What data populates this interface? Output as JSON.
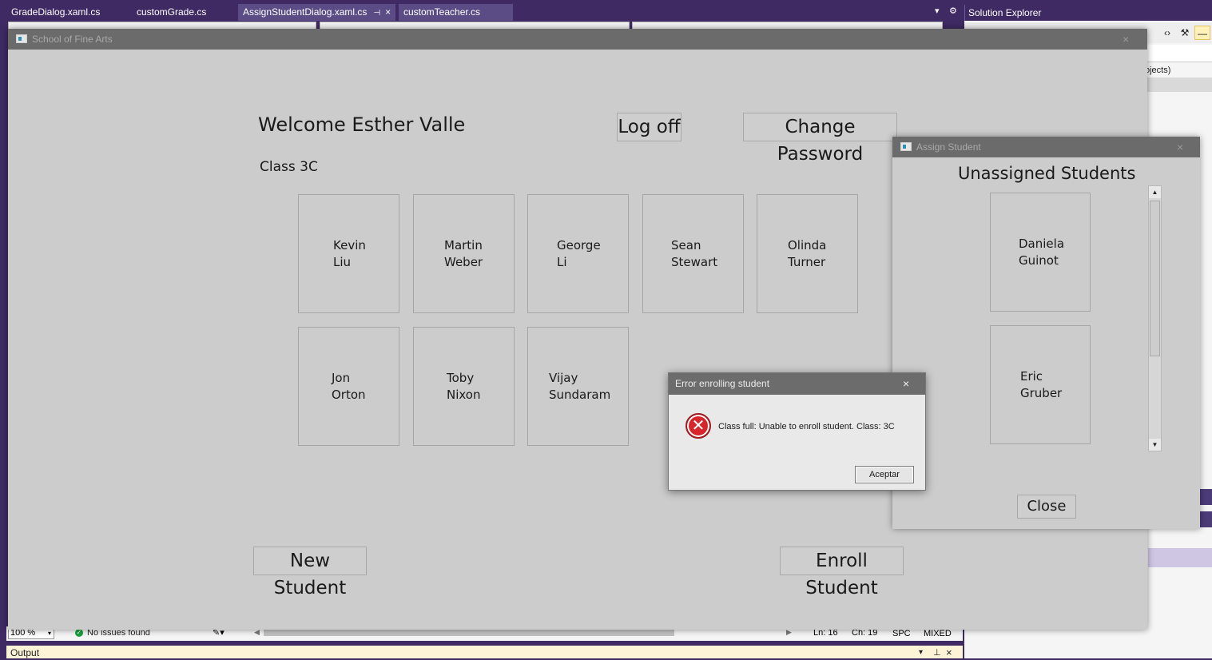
{
  "vs": {
    "tabs": [
      {
        "label": "GradeDialog.xaml.cs"
      },
      {
        "label": "customGrade.cs"
      },
      {
        "label": "AssignStudentDialog.xaml.cs",
        "pin": "⊣",
        "close": "×"
      },
      {
        "label": "customTeacher.cs"
      }
    ],
    "solution_explorer": {
      "title": "Solution Explorer",
      "row_text": "ojects)"
    },
    "status": {
      "zoom": "100 %",
      "issues": "No issues found",
      "ln": "Ln: 16",
      "ch": "Ch: 19",
      "spc": "SPC",
      "mixed": "MIXED"
    },
    "output_label": "Output"
  },
  "main_window": {
    "title": "School of Fine Arts",
    "close": "×",
    "welcome": "Welcome Esther Valle",
    "class_label": "Class 3C",
    "log_off": "Log off",
    "change_password": "Change Password",
    "new_student": "New Student",
    "enroll_student": "Enroll Student",
    "students": [
      {
        "first": "Kevin",
        "last": "Liu"
      },
      {
        "first": "Martin",
        "last": "Weber"
      },
      {
        "first": "George",
        "last": "Li"
      },
      {
        "first": "Sean",
        "last": "Stewart"
      },
      {
        "first": "Olinda",
        "last": "Turner"
      },
      {
        "first": "Jon",
        "last": "Orton"
      },
      {
        "first": "Toby",
        "last": "Nixon"
      },
      {
        "first": "Vijay",
        "last": "Sundaram"
      }
    ]
  },
  "assign_window": {
    "title": "Assign Student",
    "close": "×",
    "heading": "Unassigned Students",
    "students": [
      {
        "first": "Daniela",
        "last": "Guinot"
      },
      {
        "first": "Eric",
        "last": "Gruber"
      }
    ],
    "close_button": "Close"
  },
  "error_dialog": {
    "title": "Error enrolling student",
    "close": "×",
    "message": "Class full: Unable to enroll student. Class: 3C",
    "ok": "Aceptar"
  },
  "colors": {
    "vs_purple": "#3f2a63",
    "window_bg": "#cccccc",
    "titlebar": "#6b6b6b",
    "error_red": "#d6262b"
  }
}
